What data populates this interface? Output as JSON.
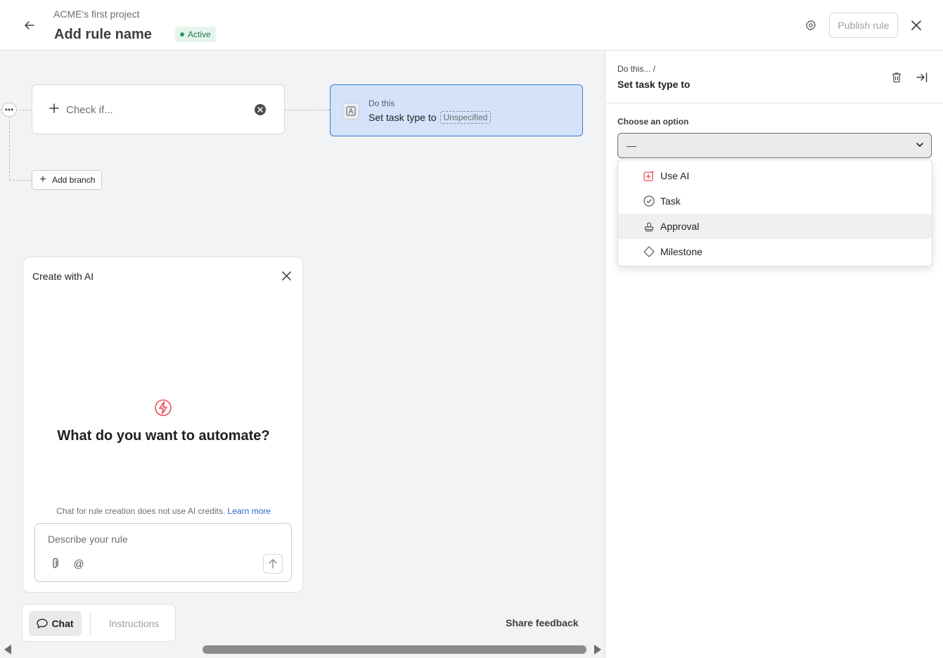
{
  "header": {
    "project_name": "ACME's first project",
    "rule_name": "Add rule name",
    "status": "Active",
    "publish_label": "Publish rule"
  },
  "canvas": {
    "check_if_label": "Check if...",
    "action": {
      "title": "Do this",
      "text": "Set task type to",
      "chip": "Unspecified"
    },
    "add_branch_label": "Add branch"
  },
  "ai_panel": {
    "title": "Create with AI",
    "headline": "What do you want to automate?",
    "note": "Chat for rule creation does not use AI credits.",
    "learn_more": "Learn more",
    "input_placeholder": "Describe your rule",
    "tabs": {
      "chat": "Chat",
      "instructions": "Instructions"
    },
    "share_feedback": "Share feedback"
  },
  "right_panel": {
    "breadcrumb": "Do this...  /",
    "title": "Set task type to",
    "field_label": "Choose an option",
    "selected_value": "—",
    "options": [
      {
        "label": "Use AI",
        "icon": "ai-sparkle-icon"
      },
      {
        "label": "Task",
        "icon": "check-circle-icon"
      },
      {
        "label": "Approval",
        "icon": "stamp-icon"
      },
      {
        "label": "Milestone",
        "icon": "diamond-icon"
      }
    ]
  },
  "colors": {
    "accent_blue": "#3e77d9",
    "action_card_bg": "#d4e2fa",
    "active_green": "#1f7a4a",
    "ai_red": "#e8505b",
    "link_blue": "#2d64c8"
  }
}
